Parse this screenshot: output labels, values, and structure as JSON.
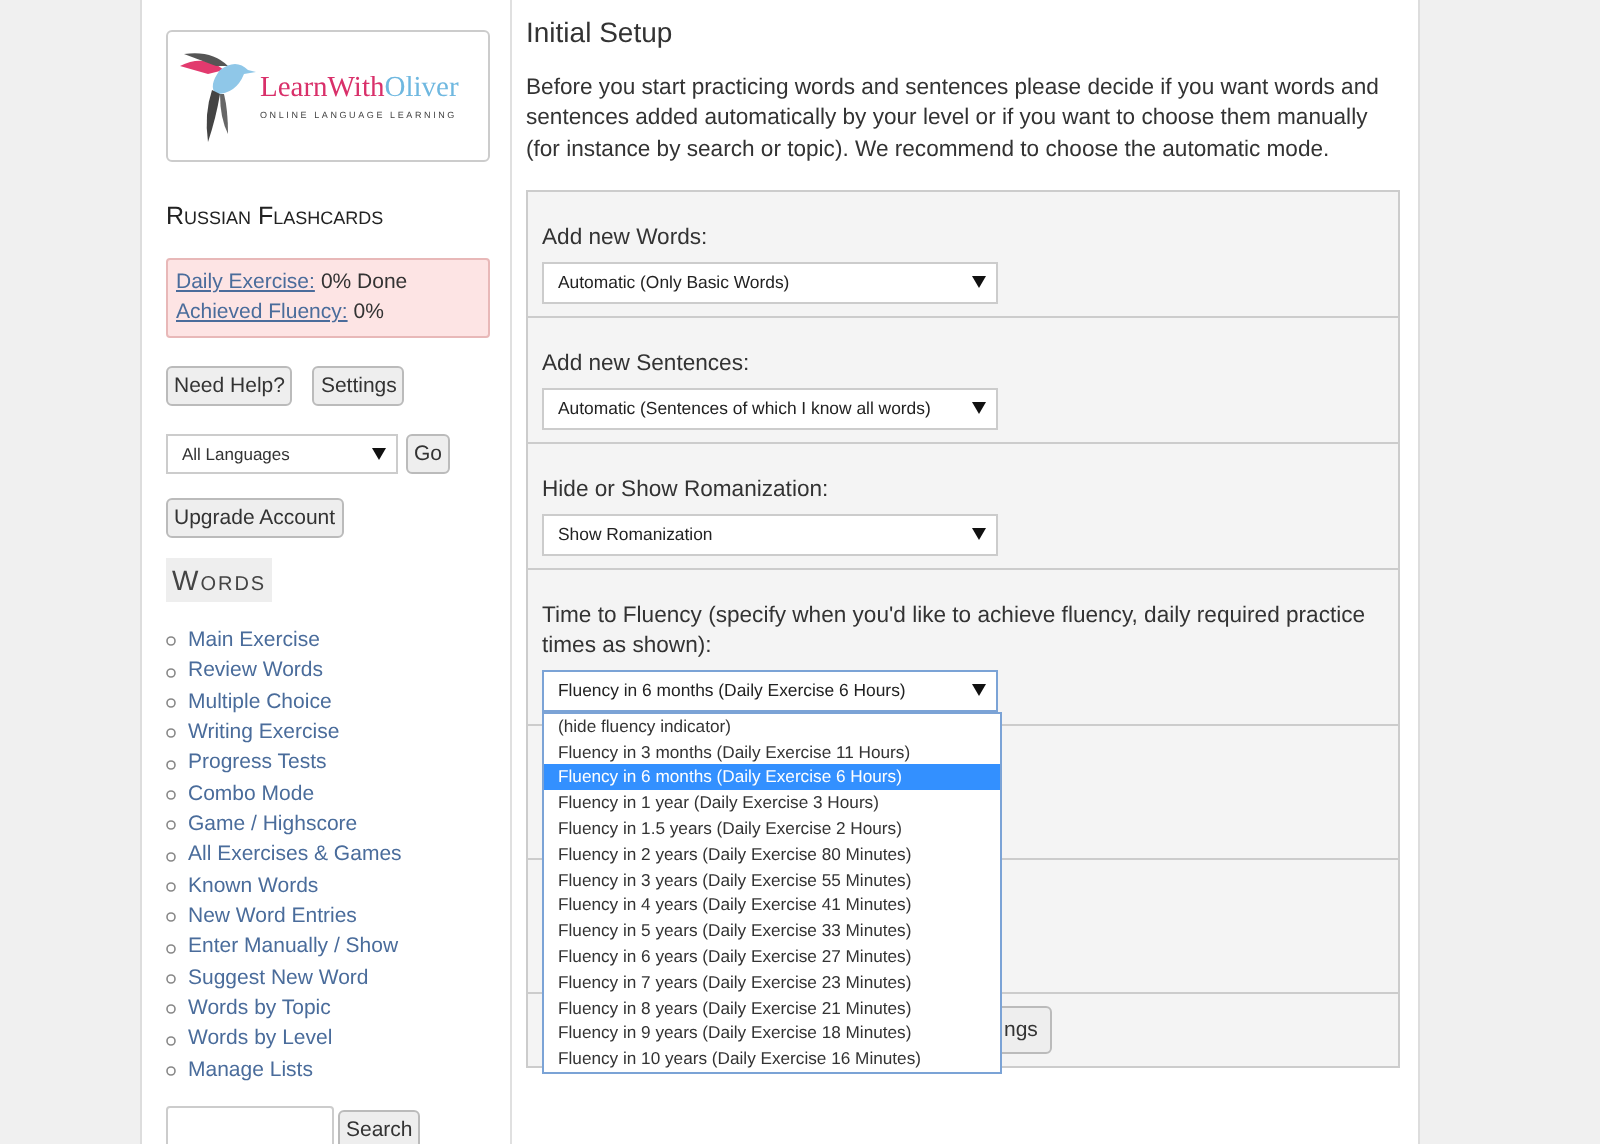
{
  "logo": {
    "parts": [
      {
        "text": "LearnWith",
        "color": "#d9306a"
      },
      {
        "text": "Oliver",
        "color": "#6fb8e0"
      }
    ],
    "tagline": "ONLINE LANGUAGE LEARNING"
  },
  "sidebar": {
    "title": "Russian Flashcards",
    "progress": [
      {
        "link": "Daily Exercise:",
        "value": "0% Done"
      },
      {
        "link": "Achieved Fluency:",
        "value": "0%"
      }
    ],
    "buttons": [
      "Need Help?",
      "Settings"
    ],
    "language_select": {
      "value": "All Languages"
    },
    "go_button": "Go",
    "upgrade_button": "Upgrade Account",
    "section_title": "Words",
    "links": [
      "Main Exercise",
      "Review Words",
      "Multiple Choice",
      "Writing Exercise",
      "Progress Tests",
      "Combo Mode",
      "Game / Highscore",
      "All Exercises & Games",
      "Known Words",
      "New Word Entries",
      "Enter Manually / Show",
      "Suggest New Word",
      "Words by Topic",
      "Words by Level",
      "Manage Lists"
    ],
    "search_button": "Search"
  },
  "main": {
    "title": "Initial Setup",
    "intro": "Before you start practicing words and sentences please decide if you want words and sentences added automatically by your level or if you want to choose them manually (for instance by search or topic). We recommend to choose the automatic mode.",
    "settings": [
      {
        "kind": "select",
        "label": "Add new Words:",
        "value": "Automatic (Only Basic Words)",
        "open": false
      },
      {
        "kind": "select",
        "label": "Add new Sentences:",
        "value": "Automatic (Sentences of which I know all words)",
        "open": false
      },
      {
        "kind": "select",
        "label": "Hide or Show Romanization:",
        "value": "Show Romanization",
        "open": false
      },
      {
        "kind": "select",
        "label": "Time to Fluency (specify when you'd like to achieve fluency, daily required practice times as shown):",
        "value": "Fluency in 6 months (Daily Exercise 6 Hours)",
        "open": true,
        "options": [
          {
            "label": "(hide fluency indicator)",
            "selected": false
          },
          {
            "label": "Fluency in 3 months (Daily Exercise 11 Hours)",
            "selected": false
          },
          {
            "label": "Fluency in 6 months (Daily Exercise 6 Hours)",
            "selected": true
          },
          {
            "label": "Fluency in 1 year (Daily Exercise 3 Hours)",
            "selected": false
          },
          {
            "label": "Fluency in 1.5 years (Daily Exercise 2 Hours)",
            "selected": false
          },
          {
            "label": "Fluency in 2 years (Daily Exercise 80 Minutes)",
            "selected": false
          },
          {
            "label": "Fluency in 3 years (Daily Exercise 55 Minutes)",
            "selected": false
          },
          {
            "label": "Fluency in 4 years (Daily Exercise 41 Minutes)",
            "selected": false
          },
          {
            "label": "Fluency in 5 years (Daily Exercise 33 Minutes)",
            "selected": false
          },
          {
            "label": "Fluency in 6 years (Daily Exercise 27 Minutes)",
            "selected": false
          },
          {
            "label": "Fluency in 7 years (Daily Exercise 23 Minutes)",
            "selected": false
          },
          {
            "label": "Fluency in 8 years (Daily Exercise 21 Minutes)",
            "selected": false
          },
          {
            "label": "Fluency in 9 years (Daily Exercise 18 Minutes)",
            "selected": false
          },
          {
            "label": "Fluency in 10 years (Daily Exercise 16 Minutes)",
            "selected": false
          }
        ]
      },
      {
        "kind": "hidden"
      },
      {
        "kind": "hidden"
      },
      {
        "kind": "button",
        "label": "ngs"
      }
    ]
  }
}
